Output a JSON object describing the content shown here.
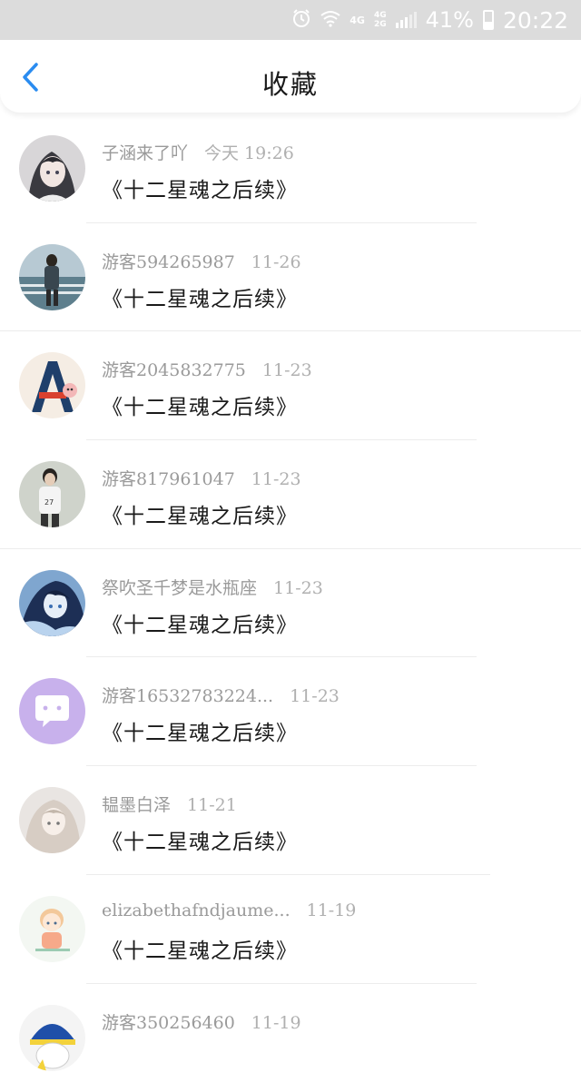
{
  "status_bar": {
    "network_top": "4G",
    "network_bottom": "4G\n2G",
    "battery_percent": "41%",
    "time": "20:22"
  },
  "header": {
    "title": "收藏"
  },
  "favorites": [
    {
      "user": "子涵来了吖",
      "time": "今天 19:26",
      "title": "《十二星魂之后续》",
      "avatar": "anime-girl"
    },
    {
      "user": "游客594265987",
      "time": "11-26",
      "title": "《十二星魂之后续》",
      "avatar": "boy-backpack"
    },
    {
      "user": "游客2045832775",
      "time": "11-23",
      "title": "《十二星魂之后续》",
      "avatar": "letter-a"
    },
    {
      "user": "游客817961047",
      "time": "11-23",
      "title": "《十二星魂之后续》",
      "avatar": "boy-27"
    },
    {
      "user": "祭吹圣千梦是水瓶座",
      "time": "11-23",
      "title": "《十二星魂之后续》",
      "avatar": "anime-blue"
    },
    {
      "user": "游客16532783224...",
      "time": "11-23",
      "title": "《十二星魂之后续》",
      "avatar": "chat-default"
    },
    {
      "user": "韫墨白泽",
      "time": "11-21",
      "title": "《十二星魂之后续》",
      "avatar": "anime-white"
    },
    {
      "user": "elizabethafndjaume...",
      "time": "11-19",
      "title": "《十二星魂之后续》",
      "avatar": "chibi-boy"
    },
    {
      "user": "游客350256460",
      "time": "11-19",
      "title": "",
      "avatar": "cartoon-hat"
    }
  ]
}
